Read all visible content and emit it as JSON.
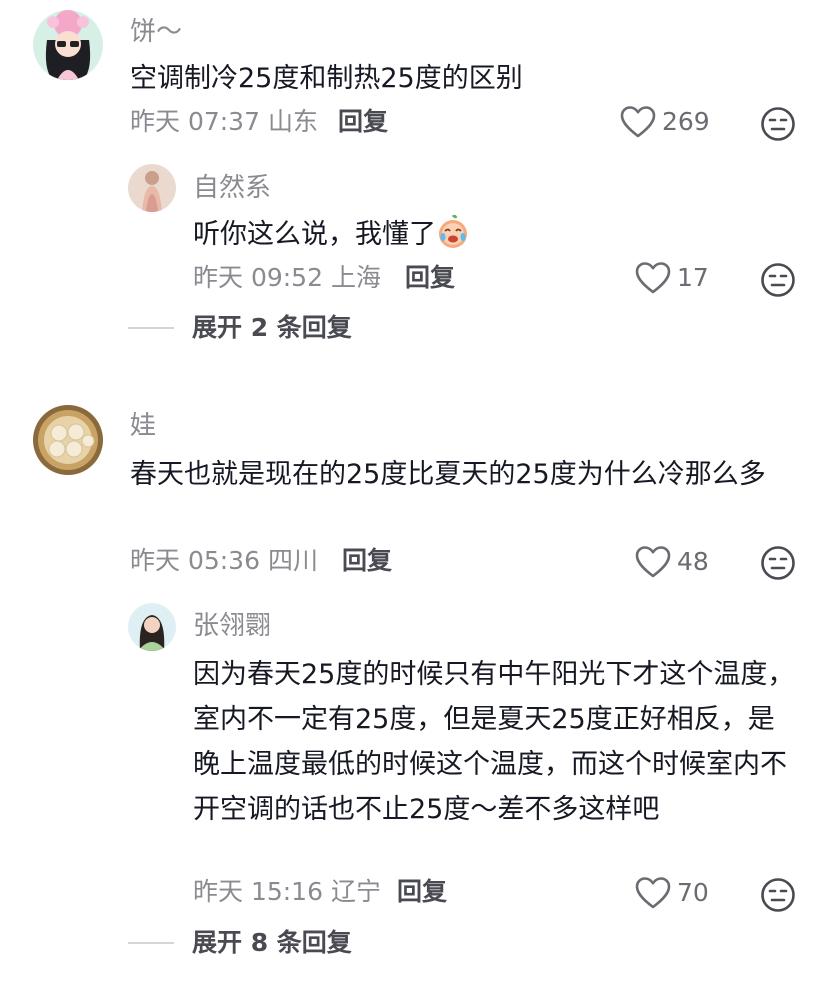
{
  "colors": {
    "text": "#161823",
    "muted": "#8a8b91",
    "action": "#4a4b52",
    "divider": "#d4d5d8"
  },
  "comments": [
    {
      "username": "饼～",
      "content": "空调制冷25度和制热25度的区别",
      "time": "昨天 07:37",
      "location": "山东",
      "reply_label": "回复",
      "likes": "269",
      "replies": [
        {
          "username": "自然系",
          "content": "听你这么说，我懂了",
          "emoji": "crying-laugh-emoji",
          "time": "昨天 09:52",
          "location": "上海",
          "reply_label": "回复",
          "likes": "17"
        }
      ],
      "expand_label": "展开 2 条回复"
    },
    {
      "username": "娃",
      "content": "春天也就是现在的25度比夏天的25度为什么冷那么多",
      "time": "昨天 05:36",
      "location": "四川",
      "reply_label": "回复",
      "likes": "48",
      "replies": [
        {
          "username": "张翎翾",
          "content": "因为春天25度的时候只有中午阳光下才这个温度，室内不一定有25度，但是夏天25度正好相反，是晚上温度最低的时候这个温度，而这个时候室内不开空调的话也不止25度～差不多这样吧",
          "time": "昨天 15:16",
          "location": "辽宁",
          "reply_label": "回复",
          "likes": "70"
        }
      ],
      "expand_label": "展开 8 条回复"
    }
  ],
  "icons": {
    "like": "heart-outline-icon",
    "emoji": "emoji-face-icon"
  }
}
